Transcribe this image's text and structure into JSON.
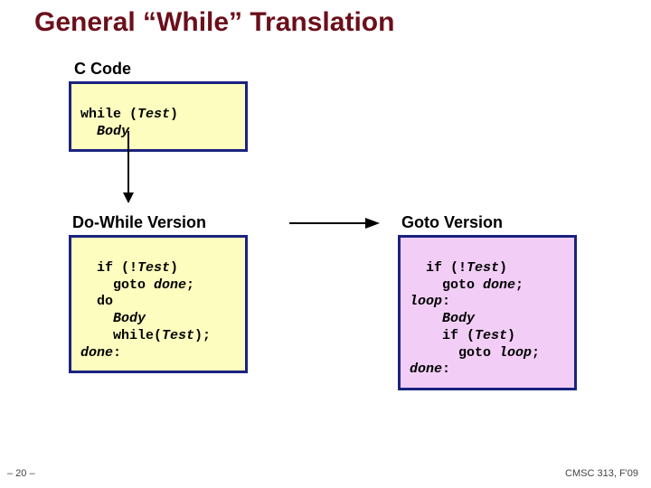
{
  "title": "General “While” Translation",
  "labels": {
    "ccode": "C Code",
    "dowhile": "Do-While Version",
    "goto": "Goto Version"
  },
  "code": {
    "ccode_l1": "while (",
    "ccode_l1b": "Test",
    "ccode_l1c": ")",
    "ccode_l2": "  ",
    "ccode_body": "Body",
    "dw_l1a": "  if (!",
    "dw_l1b": "Test",
    "dw_l1c": ")",
    "dw_l2a": "    goto ",
    "dw_l2b": "done",
    "dw_l2c": ";",
    "dw_l3": "  do",
    "dw_l4_pad": "    ",
    "dw_l4_body": "Body",
    "dw_l5a": "    while(",
    "dw_l5b": "Test",
    "dw_l5c": ");",
    "dw_l6a": "done",
    "dw_l6b": ":",
    "gv_l1a": "  if (!",
    "gv_l1b": "Test",
    "gv_l1c": ")",
    "gv_l2a": "    goto ",
    "gv_l2b": "done",
    "gv_l2c": ";",
    "gv_l3a": "loop",
    "gv_l3b": ":",
    "gv_l4_pad": "    ",
    "gv_l4_body": "Body",
    "gv_l5a": "    if (",
    "gv_l5b": "Test",
    "gv_l5c": ")",
    "gv_l6a": "      goto ",
    "gv_l6b": "loop",
    "gv_l6c": ";",
    "gv_l7a": "done",
    "gv_l7b": ":"
  },
  "footer": {
    "page": "– 20 –",
    "course": "CMSC 313, F'09"
  }
}
